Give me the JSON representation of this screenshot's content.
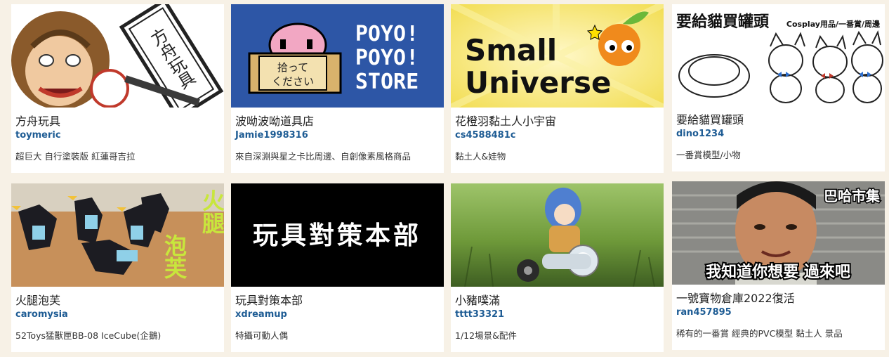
{
  "shops": [
    {
      "name": "方舟玩具",
      "owner": "toymeric",
      "description": "超巨大 自行塗裝版 紅蓮哥吉拉",
      "thumb_text": "方舟玩具",
      "thumb_colors": {
        "bg": "#ffffff",
        "accent": "#c0392b"
      }
    },
    {
      "name": "波呦波呦道具店",
      "owner": "Jamie1998316",
      "description": "來自深淵與星之卡比周邊、自創像素風格商品",
      "thumb_text_lines": [
        "POYO!",
        "POYO!",
        "STORE"
      ],
      "thumb_sign_lines": [
        "拾って",
        "ください"
      ],
      "thumb_colors": {
        "bg": "#2d56a6",
        "accent": "#f2a7c3"
      }
    },
    {
      "name": "花橙羽黏土人小宇宙",
      "owner": "cs4588481c",
      "description": "黏土人&娃物",
      "thumb_text_lines": [
        "Small",
        "Universe"
      ],
      "thumb_colors": {
        "bg": "#f4e46a",
        "accent": "#f08a1c"
      }
    },
    {
      "name": "要給貓買罐頭",
      "owner": "dino1234",
      "description": "一番賞模型/小物",
      "thumb_title": "要給貓買罐頭",
      "thumb_subtitle": "Cosplay用品/一番賞/周邊",
      "thumb_colors": {
        "bg": "#ffffff",
        "accent": "#2d6fcf"
      }
    },
    {
      "name": "火腿泡芙",
      "owner": "caromysia",
      "description": "52Toys猛獸匣BB-08 IceCube(企鵝)",
      "thumb_text_lines": [
        "火腿",
        "泡芙"
      ],
      "thumb_colors": {
        "bg": "#c7905a",
        "accent": "#c8e63c"
      }
    },
    {
      "name": "玩具對策本部",
      "owner": "xdreamup",
      "description": "特攝可動人偶",
      "thumb_text": "玩具對策本部",
      "thumb_colors": {
        "bg": "#000000",
        "accent": "#ffffff"
      }
    },
    {
      "name": "小豬噗滿",
      "owner": "tttt33321",
      "description": "1/12場景&配件",
      "thumb_colors": {
        "bg": "#6f9a3a",
        "accent": "#4f7fd0"
      }
    },
    {
      "name": "一號寶物倉庫2022復活",
      "owner": "ran457895",
      "description": "稀有的一番賞 經典的PVC模型 黏土人 景品",
      "thumb_tag": "巴哈市集",
      "thumb_caption": "我知道你想要 過來吧",
      "thumb_colors": {
        "bg": "#8a8a86",
        "accent": "#ffffff"
      }
    }
  ]
}
